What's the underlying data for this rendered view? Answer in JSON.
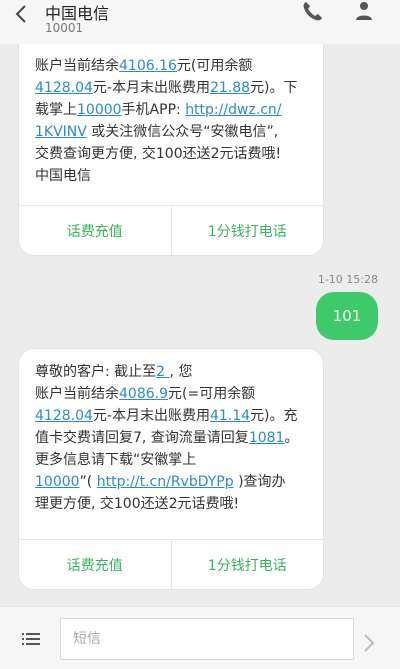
{
  "header": {
    "title": "中国电信",
    "subtitle": "10001"
  },
  "messages": [
    {
      "segments": [
        {
          "t": "账户当前结余"
        },
        {
          "t": "4106.16",
          "link": true
        },
        {
          "t": "元(可用余额"
        },
        {
          "br": true
        },
        {
          "t": "4128.04",
          "link": true
        },
        {
          "t": "元-本月末出账费用"
        },
        {
          "t": "21.88",
          "link": true
        },
        {
          "t": "元)。下"
        },
        {
          "br": true
        },
        {
          "t": "载掌上"
        },
        {
          "t": "10000",
          "link": true
        },
        {
          "t": "手机APP: "
        },
        {
          "t": "http://dwz.cn/",
          "link": true
        },
        {
          "br": true
        },
        {
          "t": "1KVINV",
          "link": true
        },
        {
          "t": " 或关注微信公众号“安徽电信”,"
        },
        {
          "br": true
        },
        {
          "t": "交费查询更方便, 交100还送2元话费哦!"
        },
        {
          "br": true
        },
        {
          "t": "中国电信"
        }
      ],
      "actions": [
        "话费充值",
        "1分钱打电话"
      ]
    },
    {
      "segments": [
        {
          "t": "尊敬的客户: 截止至"
        },
        {
          "t": "2",
          "link": true
        },
        {
          "t": "                        ",
          "link": true
        },
        {
          "t": ", 您"
        },
        {
          "br": true
        },
        {
          "t": "账户当前结余"
        },
        {
          "t": "4086.9",
          "link": true
        },
        {
          "t": "元(=可用余额"
        },
        {
          "br": true
        },
        {
          "t": "4128.04",
          "link": true
        },
        {
          "t": "元-本月末出账费用"
        },
        {
          "t": "41.14",
          "link": true
        },
        {
          "t": "元)。充"
        },
        {
          "br": true
        },
        {
          "t": "值卡交费请回复7, 查询流量请回复"
        },
        {
          "t": "1081",
          "link": true
        },
        {
          "t": "。"
        },
        {
          "br": true
        },
        {
          "t": "更多信息请下载“安徽掌上"
        },
        {
          "br": true
        },
        {
          "t": "10000",
          "link": true
        },
        {
          "t": "”( "
        },
        {
          "t": "http://t.cn/RvbDYPp",
          "link": true
        },
        {
          "t": " )查询办"
        },
        {
          "br": true
        },
        {
          "t": "理更方便, 交100还送2元话费哦!"
        }
      ],
      "actions": [
        "话费充值",
        "1分钱打电话"
      ]
    }
  ],
  "outgoing": {
    "timestamp": "1-10 15:28",
    "text": "101"
  },
  "composer": {
    "placeholder": "短信"
  },
  "colors": {
    "accent_green": "#3ec96a",
    "action_green": "#3ab35c",
    "link_blue": "#2a8ad8"
  },
  "icons": [
    "back-arrow-icon",
    "phone-icon",
    "person-icon",
    "menu-list-icon",
    "send-chevron-icon"
  ]
}
